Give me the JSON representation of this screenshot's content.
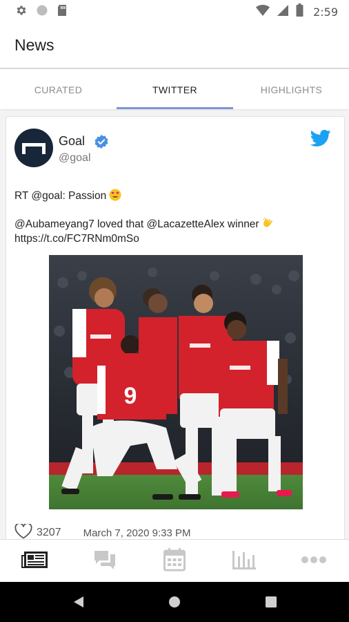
{
  "status_bar": {
    "time": "2:59",
    "icons": [
      "settings-icon",
      "circle-icon",
      "sd-card-icon",
      "wifi-icon",
      "signal-icon",
      "battery-icon"
    ]
  },
  "app_bar": {
    "title": "News"
  },
  "tabs": [
    {
      "label": "CURATED",
      "active": false
    },
    {
      "label": "TWITTER",
      "active": true
    },
    {
      "label": "HIGHLIGHTS",
      "active": false
    }
  ],
  "tweet": {
    "author_name": "Goal",
    "author_handle": "@goal",
    "text_line1": "RT @goal: Passion",
    "text_line2": "@Aubameyang7 loved that @LacazetteAlex winner",
    "text_line3": "https://t.co/FC7RNm0mSo",
    "likes": "3207",
    "date": "March 7, 2020 9:33 PM",
    "emojis": [
      "heart-eyes-emoji",
      "raising-hands-emoji"
    ],
    "image_description_icon": "football-celebration-photo"
  },
  "bottom_nav": [
    {
      "icon": "newspaper-icon",
      "active": true
    },
    {
      "icon": "chat-icon",
      "active": false
    },
    {
      "icon": "calendar-icon",
      "active": false
    },
    {
      "icon": "bar-chart-icon",
      "active": false
    },
    {
      "icon": "more-icon",
      "active": false
    }
  ],
  "colors": {
    "accent": "#7b96d6",
    "twitter_blue": "#1da1f2",
    "verified_blue": "#4a90e2",
    "avatar_bg": "#172638",
    "nav_active": "#222222",
    "nav_inactive": "#bfbfbf"
  }
}
